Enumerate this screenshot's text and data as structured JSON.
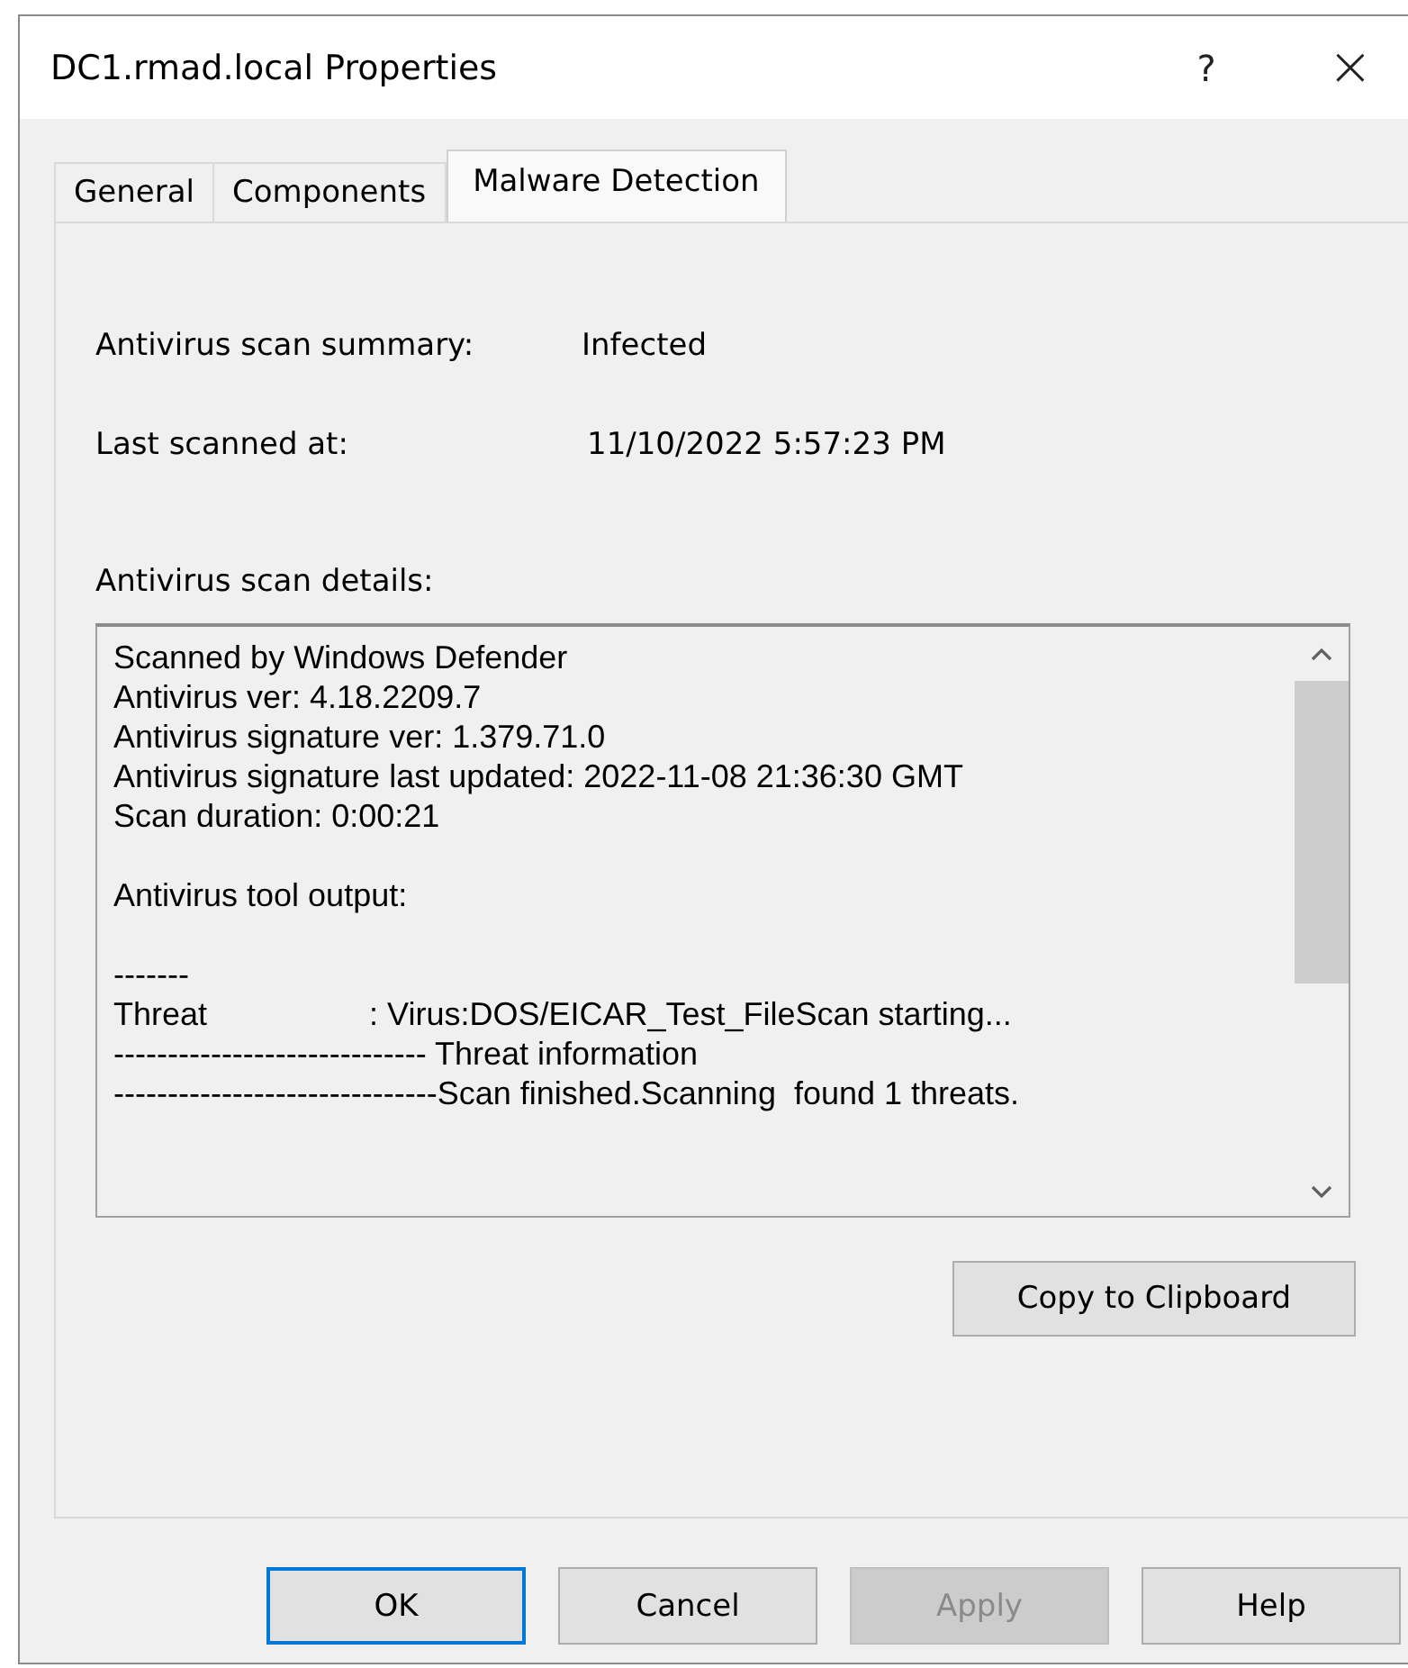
{
  "window": {
    "title": "DC1.rmad.local Properties",
    "help": "?",
    "close": "×"
  },
  "tabs": [
    {
      "label": "General",
      "selected": false
    },
    {
      "label": "Components",
      "selected": false
    },
    {
      "label": "Malware Detection",
      "selected": true
    }
  ],
  "summary": [
    {
      "label": "Antivirus scan summary:",
      "value": "Infected"
    },
    {
      "label": "Last scanned at:",
      "value": "11/10/2022 5:57:23 PM"
    }
  ],
  "details": {
    "label": "Antivirus scan details:",
    "paragraphs": [
      [
        "Scanned by Windows Defender",
        "Antivirus ver: 4.18.2209.7",
        "Antivirus signature ver: 1.379.71.0",
        "Antivirus signature last updated: 2022-11-08 21:36:30 GMT",
        "Scan duration: 0:00:21"
      ],
      [
        "Antivirus tool output:"
      ],
      [
        "-------",
        "Threat                  : Virus:DOS/EICAR_Test_FileScan starting...",
        "----------------------------- Threat information",
        "------------------------------Scan finished.Scanning  found 1 threats."
      ]
    ]
  },
  "copy_button": {
    "label": "Copy to Clipboard"
  },
  "buttons": [
    {
      "label": "OK",
      "default": true,
      "disabled": false
    },
    {
      "label": "Cancel",
      "default": false,
      "disabled": false
    },
    {
      "label": "Apply",
      "default": false,
      "disabled": true
    },
    {
      "label": "Help",
      "default": false,
      "disabled": false
    }
  ]
}
